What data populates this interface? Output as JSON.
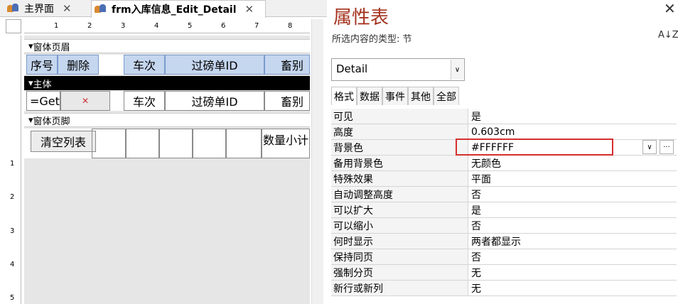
{
  "tabs": [
    {
      "label": "主界面",
      "close": "✕"
    },
    {
      "label": "frm入库信息_Edit_Detail",
      "close": "✕"
    }
  ],
  "ruler": {
    "h": [
      "1",
      "2",
      "3",
      "4",
      "5",
      "6",
      "7",
      "8"
    ],
    "v": [
      "1",
      "2",
      "3",
      "4",
      "5"
    ]
  },
  "sections": {
    "header": "窗体页眉",
    "detail": "主体",
    "footer": "窗体页脚"
  },
  "header_cells": [
    "序号",
    "删除",
    "车次",
    "过磅单ID",
    "畜别"
  ],
  "detail_cells": {
    "expr": "=Get",
    "col3": "车次",
    "col4": "过磅单ID",
    "col5": "畜别"
  },
  "footer": {
    "button": "清空列表",
    "label": "数量小计"
  },
  "props": {
    "title": "属性表",
    "subtitle": "所选内容的类型: 节",
    "sort_icon": "A↓Z",
    "close": "✕",
    "selected": "Detail",
    "tabs": [
      "格式",
      "数据",
      "事件",
      "其他",
      "全部"
    ],
    "rows": [
      {
        "k": "可见",
        "v": "是"
      },
      {
        "k": "高度",
        "v": "0.603cm"
      },
      {
        "k": "背景色",
        "v": "#FFFFFF"
      },
      {
        "k": "备用背景色",
        "v": "无颜色"
      },
      {
        "k": "特殊效果",
        "v": "平面"
      },
      {
        "k": "自动调整高度",
        "v": "否"
      },
      {
        "k": "可以扩大",
        "v": "是"
      },
      {
        "k": "可以缩小",
        "v": "否"
      },
      {
        "k": "何时显示",
        "v": "两者都显示"
      },
      {
        "k": "保持同页",
        "v": "否"
      },
      {
        "k": "强制分页",
        "v": "无"
      },
      {
        "k": "新行或新列",
        "v": "无"
      }
    ]
  },
  "colors": {
    "title": "#a5331f",
    "highlight": "#d42f2f",
    "header_cell": "#c5d6ef"
  }
}
